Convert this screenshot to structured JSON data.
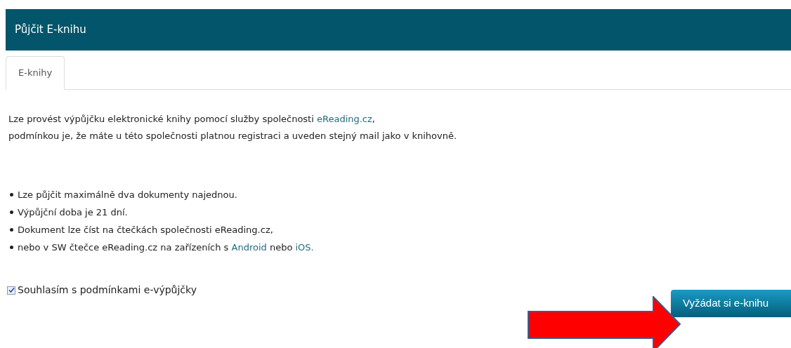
{
  "panel": {
    "title": "Půjčit E-knihu"
  },
  "tabs": [
    {
      "label": "E-knihy",
      "selected": true
    }
  ],
  "intro": [
    [
      {
        "kind": "text",
        "text": "Lze provést výpůjčku elektronické knihy pomocí služby společnosti "
      },
      {
        "kind": "link",
        "text": "eReading.cz"
      },
      {
        "kind": "text",
        "text": ","
      }
    ],
    [
      {
        "kind": "text",
        "text": "podmínkou je, že máte u této společnosti platnou registraci a uveden stejný mail jako v knihovně."
      }
    ]
  ],
  "conditions": [
    [
      {
        "kind": "text",
        "text": "Lze půjčit maximálně dva dokumenty najednou."
      }
    ],
    [
      {
        "kind": "text",
        "text": "Výpůjční doba je 21 dní."
      }
    ],
    [
      {
        "kind": "text",
        "text": "Dokument lze číst na čtečkách společnosti eReading.cz,"
      }
    ],
    [
      {
        "kind": "text",
        "text": "nebo v SW čtečce eReading.cz na zařízeních s "
      },
      {
        "kind": "link",
        "text": "Android"
      },
      {
        "kind": "text",
        "text": " nebo "
      },
      {
        "kind": "link",
        "text": "iOS."
      }
    ]
  ],
  "agreement": {
    "label": "Souhlasím s podmínkami e-výpůjčky",
    "checked": true
  },
  "submit_button": {
    "label": "Vyžádat si e-knihu"
  }
}
